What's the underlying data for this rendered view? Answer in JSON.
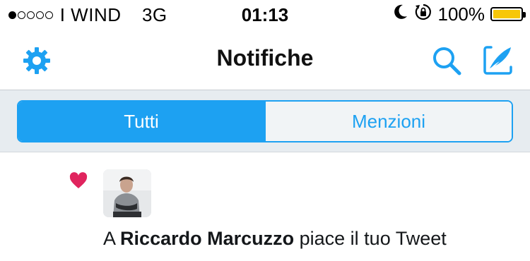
{
  "status_bar": {
    "signal_dots_filled": 1,
    "signal_dots_total": 5,
    "carrier": "I WIND",
    "network": "3G",
    "time": "01:13",
    "battery_percent": "100%",
    "battery_level": 1.0,
    "battery_color": "#f7c708"
  },
  "nav": {
    "title": "Notifiche",
    "left_icon": "gear-icon",
    "right_icons": [
      "search-icon",
      "compose-icon"
    ]
  },
  "tabs": [
    {
      "label": "Tutti",
      "selected": true
    },
    {
      "label": "Menzioni",
      "selected": false
    }
  ],
  "notification": {
    "type_icon": "heart-icon",
    "prefix": "A",
    "user_name": "Riccardo Marcuzzo",
    "suffix": "piace il tuo Tweet"
  },
  "colors": {
    "accent": "#1da1f2",
    "like": "#e0245e",
    "segment_background": "#e7ecf0"
  }
}
